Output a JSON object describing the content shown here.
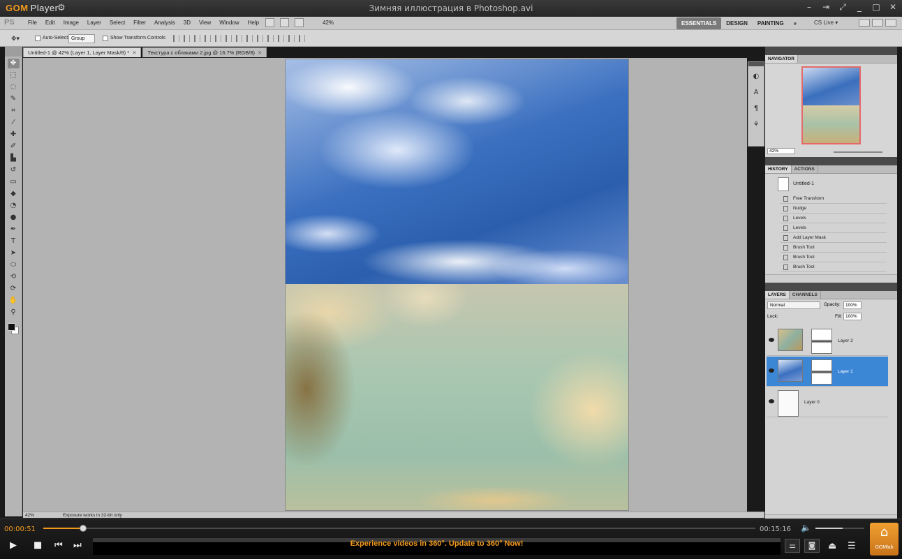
{
  "player": {
    "logo_gom": "GOM",
    "logo_player": "Player",
    "title": "Зимняя иллюстрация в Photoshop.avi",
    "time_current": "00:00:51",
    "time_total": "00:15:16",
    "progress_fraction": 0.056,
    "volume_fraction": 0.55,
    "banner": "Experience videos in 360°. Update to 360° Now!",
    "gomlab_label": "GOMlab"
  },
  "photoshop": {
    "logo": "PS",
    "menu": [
      "File",
      "Edit",
      "Image",
      "Layer",
      "Select",
      "Filter",
      "Analysis",
      "3D",
      "View",
      "Window",
      "Help"
    ],
    "zoom": "42%",
    "workspaces": [
      "ESSENTIALS",
      "DESIGN",
      "PAINTING",
      "»"
    ],
    "active_workspace": "ESSENTIALS",
    "cs_live": "CS Live ▾",
    "options": {
      "auto_select_label": "Auto-Select:",
      "auto_select_value": "Group",
      "show_transform_label": "Show Transform Controls"
    },
    "tabs": [
      {
        "label": "Untitled-1 @ 42% (Layer 1, Layer Mask/8) *"
      },
      {
        "label": "Текстура с облаками 2.jpg @ 16.7% (RGB/8)"
      }
    ],
    "status": {
      "zoom": "42%",
      "message": "Exposure works in 32-bit only"
    },
    "navigator": {
      "tab": "NAVIGATOR",
      "zoom": "42%"
    },
    "history": {
      "tabs": [
        "HISTORY",
        "ACTIONS"
      ],
      "snapshot": "Untitled-1",
      "items": [
        "Free Transform",
        "Nudge",
        "Levels",
        "Levels",
        "Add Layer Mask",
        "Brush Tool",
        "Brush Tool",
        "Brush Tool"
      ]
    },
    "layers": {
      "tabs": [
        "LAYERS",
        "CHANNELS"
      ],
      "blend_mode": "Normal",
      "opacity_label": "Opacity:",
      "opacity": "100%",
      "lock_label": "Lock:",
      "fill_label": "Fill:",
      "fill": "100%",
      "items": [
        {
          "name": "Layer 2",
          "selected": false
        },
        {
          "name": "Layer 1",
          "selected": true
        },
        {
          "name": "Layer 0",
          "selected": false
        }
      ]
    }
  },
  "colors": {
    "accent": "#f39a1e",
    "selection": "#3c86d6"
  }
}
